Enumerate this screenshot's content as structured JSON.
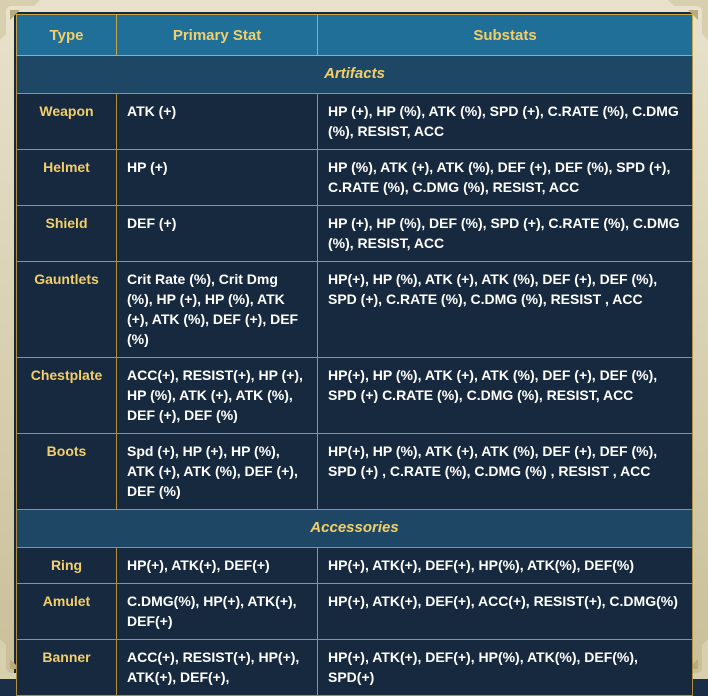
{
  "header": {
    "type": "Type",
    "primary": "Primary Stat",
    "substats": "Substats"
  },
  "sections": [
    {
      "title": "Artifacts",
      "rows": [
        {
          "type": "Weapon",
          "primary": "ATK (+)",
          "substats": "HP (+), HP (%), ATK (%), SPD (+), C.RATE (%), C.DMG (%), RESIST, ACC"
        },
        {
          "type": "Helmet",
          "primary": "HP (+)",
          "substats": "HP (%), ATK (+), ATK (%), DEF (+), DEF (%), SPD (+), C.RATE (%), C.DMG (%), RESIST, ACC"
        },
        {
          "type": "Shield",
          "primary": "DEF (+)",
          "substats": "HP (+), HP (%), DEF (%), SPD (+), C.RATE (%), C.DMG (%), RESIST, ACC"
        },
        {
          "type": "Gauntlets",
          "primary": "Crit Rate (%), Crit Dmg (%), HP (+), HP (%), ATK (+), ATK (%), DEF (+), DEF (%)",
          "substats": "HP(+), HP (%), ATK (+), ATK (%), DEF (+), DEF (%), SPD (+), C.RATE (%), C.DMG (%), RESIST , ACC"
        },
        {
          "type": "Chestplate",
          "primary": "ACC(+), RESIST(+), HP (+), HP (%), ATK (+), ATK (%), DEF (+), DEF (%)",
          "substats": "HP(+), HP (%), ATK (+), ATK (%), DEF (+), DEF (%), SPD (+) C.RATE (%), C.DMG (%), RESIST, ACC"
        },
        {
          "type": "Boots",
          "primary": "Spd (+), HP (+), HP (%), ATK (+), ATK (%), DEF (+), DEF (%)",
          "substats": "HP(+), HP (%), ATK (+), ATK (%), DEF (+), DEF (%), SPD (+) , C.RATE (%), C.DMG (%) , RESIST , ACC"
        }
      ]
    },
    {
      "title": "Accessories",
      "rows": [
        {
          "type": "Ring",
          "primary": "HP(+), ATK(+), DEF(+)",
          "substats": "HP(+), ATK(+), DEF(+), HP(%), ATK(%), DEF(%)"
        },
        {
          "type": "Amulet",
          "primary": "C.DMG(%), HP(+), ATK(+), DEF(+)",
          "substats": "HP(+), ATK(+), DEF(+), ACC(+), RESIST(+), C.DMG(%)"
        },
        {
          "type": "Banner",
          "primary": "ACC(+), RESIST(+), HP(+), ATK(+), DEF(+),",
          "substats": "HP(+), ATK(+), DEF(+), HP(%), ATK(%), DEF(%), SPD(+)"
        }
      ]
    }
  ],
  "colors": {
    "header_bg": "#1f6f99",
    "gold_text": "#f2cf6a",
    "section_bg": "#1d4765",
    "cell_bg": "#17293f",
    "border": "#b08f3e"
  }
}
